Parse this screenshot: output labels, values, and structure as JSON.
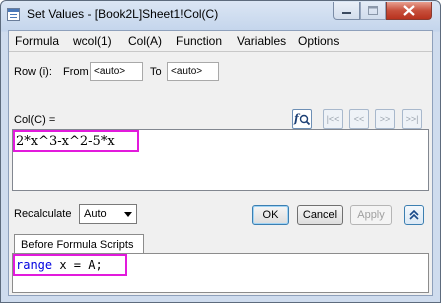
{
  "window": {
    "title": "Set Values - [Book2L]Sheet1!Col(C)"
  },
  "menu": [
    "Formula",
    "wcol(1)",
    "Col(A)",
    "Function",
    "Variables",
    "Options"
  ],
  "row_range": {
    "label": "Row (i):",
    "from_label": "From",
    "from_value": "<auto>",
    "to_label": "To",
    "to_value": "<auto>"
  },
  "formula_label": "Col(C) =",
  "formula": "2*x^3-x^2-5*x",
  "nav_icons": [
    "search-formula-icon",
    "first-icon",
    "previous-icon",
    "next-icon",
    "last-icon"
  ],
  "nav_glyphs": {
    "first": "|<<",
    "prev": "<<",
    "next": ">>",
    "last": ">>|"
  },
  "recalculate": {
    "label": "Recalculate",
    "value": "Auto"
  },
  "buttons": {
    "ok": "OK",
    "cancel": "Cancel",
    "apply": "Apply",
    "expand": "⌃"
  },
  "tab": {
    "label": "Before Formula Scripts"
  },
  "script": {
    "keyword": "range",
    "rest": " x = A;"
  },
  "colors": {
    "highlight": "#e21adc",
    "keyword": "#0000e0",
    "title_bg": "#c4d5ec",
    "dialog_bg": "#f0f0f0"
  }
}
